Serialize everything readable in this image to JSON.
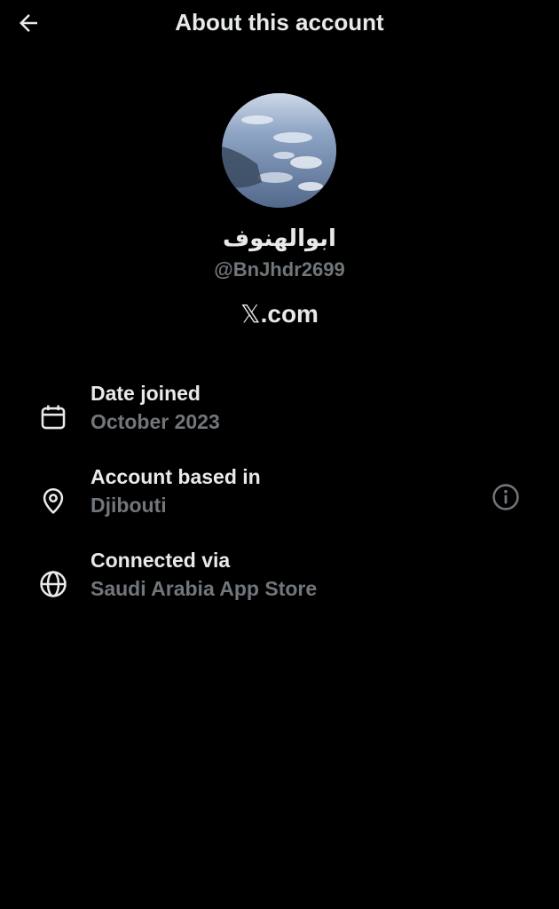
{
  "header": {
    "title": "About this account",
    "back_icon": "arrow-left-icon"
  },
  "profile": {
    "display_name": "ابوالهنوف",
    "handle": "@BnJhdr2699",
    "source_mark": "𝕏",
    "source_suffix": ".com"
  },
  "details": [
    {
      "icon": "calendar-icon",
      "label": "Date joined",
      "value": "October 2023"
    },
    {
      "icon": "location-pin-icon",
      "label": "Account based in",
      "value": "Djibouti",
      "action_icon": "info-icon"
    },
    {
      "icon": "globe-icon",
      "label": "Connected via",
      "value": "Saudi Arabia App Store"
    }
  ],
  "colors": {
    "background": "#000000",
    "primary_text": "#e7e9ea",
    "secondary_text": "#71767b"
  }
}
